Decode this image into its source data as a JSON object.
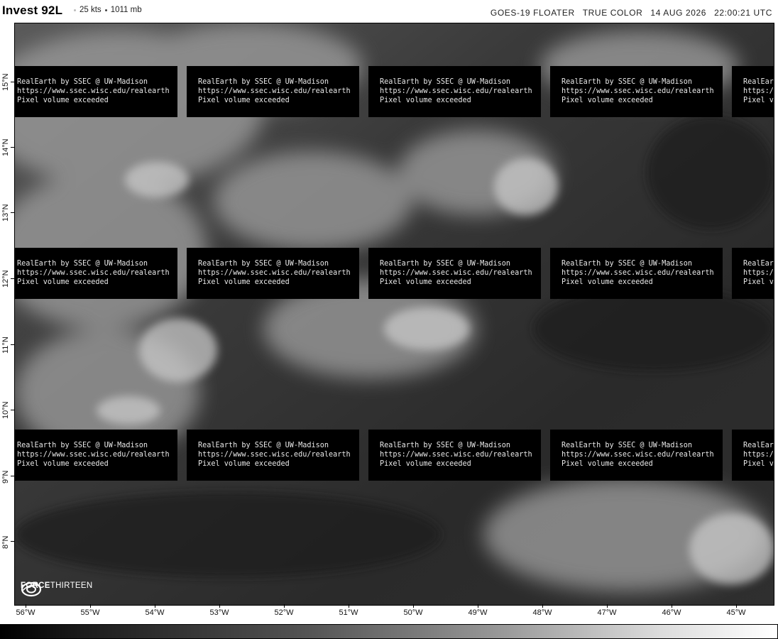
{
  "header": {
    "storm_name": "Invest 92L",
    "wind": "25 kts",
    "pressure": "1011 mb",
    "product": "GOES-19 FLOATER",
    "band": "TRUE COLOR",
    "date": "14 AUG 2026",
    "time": "22:00:21 UTC"
  },
  "watermark": {
    "line1": "RealEarth by SSEC @ UW-Madison",
    "line2": "https://www.ssec.wisc.edu/realearth",
    "line3": "Pixel volume exceeded"
  },
  "logo": {
    "bold": "FORCE",
    "regular": "THIRTEEN",
    "icon": "force-thirteen-logo-icon"
  },
  "lat_labels": [
    "15°N",
    "14°N",
    "13°N",
    "12°N",
    "11°N",
    "10°N",
    "9°N",
    "8°N"
  ],
  "lon_labels": [
    "56°W",
    "55°W",
    "54°W",
    "53°W",
    "52°W",
    "51°W",
    "50°W",
    "49°W",
    "48°W",
    "47°W",
    "46°W",
    "45°W"
  ],
  "colors": {
    "banner_bg": "#000000",
    "map_bg": "#2b2b2b"
  }
}
